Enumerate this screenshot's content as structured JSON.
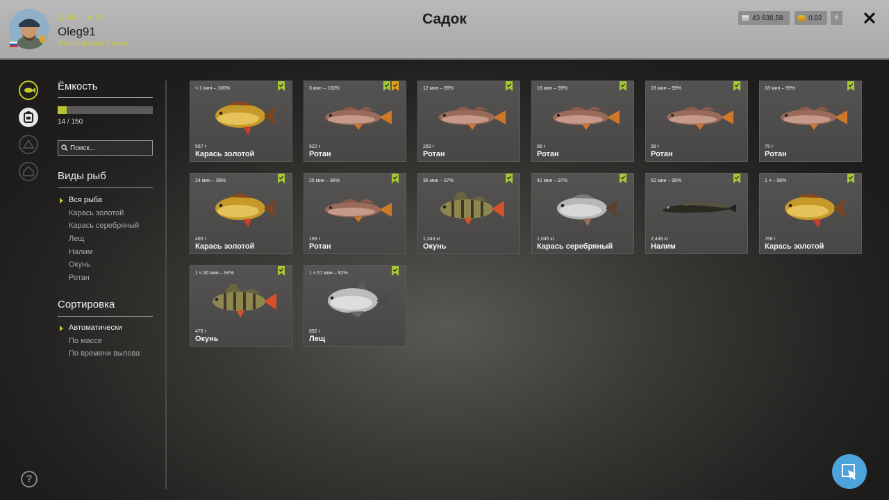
{
  "header": {
    "title": "Садок",
    "player": {
      "name": "Oleg91",
      "level": "38",
      "stars": "15",
      "rank": "Мастер фидера 2 ранга"
    },
    "silver": "43 638,58",
    "gold": "0,02",
    "plus_label": "+"
  },
  "side_icons": [
    "fish-keepnet-icon",
    "backpack-icon",
    "camp-icon",
    "home-icon"
  ],
  "capacity": {
    "title": "Ёмкость",
    "used": 14,
    "max": 150,
    "text": "14 / 150",
    "fill_fraction": 0.093
  },
  "search": {
    "placeholder": "Поиск..."
  },
  "species": {
    "title": "Виды рыб",
    "items": [
      "Вся рыба",
      "Карась золотой",
      "Карась серебряный",
      "Лещ",
      "Налим",
      "Окунь",
      "Ротан"
    ],
    "selected": 0
  },
  "sort": {
    "title": "Сортировка",
    "items": [
      "Автоматически",
      "По массе",
      "По времени вылова"
    ],
    "selected": 0
  },
  "fish": [
    {
      "time": "< 1 мин – 100%",
      "weight": "567 г",
      "name": "Карась золотой",
      "kind": "goldcrucian",
      "trophy": false
    },
    {
      "time": "3 мин – 100%",
      "weight": "522 г",
      "name": "Ротан",
      "kind": "rotan",
      "trophy": true
    },
    {
      "time": "12 мин – 99%",
      "weight": "283 г",
      "name": "Ротан",
      "kind": "rotan",
      "trophy": false
    },
    {
      "time": "16 мин – 99%",
      "weight": "96 г",
      "name": "Ротан",
      "kind": "rotan",
      "trophy": false
    },
    {
      "time": "18 мин – 99%",
      "weight": "99 г",
      "name": "Ротан",
      "kind": "rotan",
      "trophy": false
    },
    {
      "time": "18 мин – 99%",
      "weight": "75 г",
      "name": "Ротан",
      "kind": "rotan",
      "trophy": false
    },
    {
      "time": "24 мин – 98%",
      "weight": "465 г",
      "name": "Карась золотой",
      "kind": "goldcrucian",
      "trophy": false
    },
    {
      "time": "25 мин – 98%",
      "weight": "169 г",
      "name": "Ротан",
      "kind": "rotan",
      "trophy": false
    },
    {
      "time": "36 мин – 97%",
      "weight": "1,343 кг",
      "name": "Окунь",
      "kind": "perch",
      "trophy": false
    },
    {
      "time": "42 мин – 97%",
      "weight": "1,045 кг",
      "name": "Карась серебряный",
      "kind": "silvercrucian",
      "trophy": false
    },
    {
      "time": "52 мин – 96%",
      "weight": "2,449 кг",
      "name": "Налим",
      "kind": "burbot",
      "trophy": false
    },
    {
      "time": "1 ч – 96%",
      "weight": "768 г",
      "name": "Карась золотой",
      "kind": "goldcrucian",
      "trophy": false
    },
    {
      "time": "1 ч 30 мин – 94%",
      "weight": "476 г",
      "name": "Окунь",
      "kind": "perch",
      "trophy": false
    },
    {
      "time": "1 ч 57 мин – 92%",
      "weight": "892 г",
      "name": "Лещ",
      "kind": "bream",
      "trophy": false
    }
  ],
  "colors": {
    "accent": "#c4cc28",
    "badge_green": "#a6c934",
    "badge_gold": "#e0a21a",
    "fab": "#4da3dc"
  }
}
